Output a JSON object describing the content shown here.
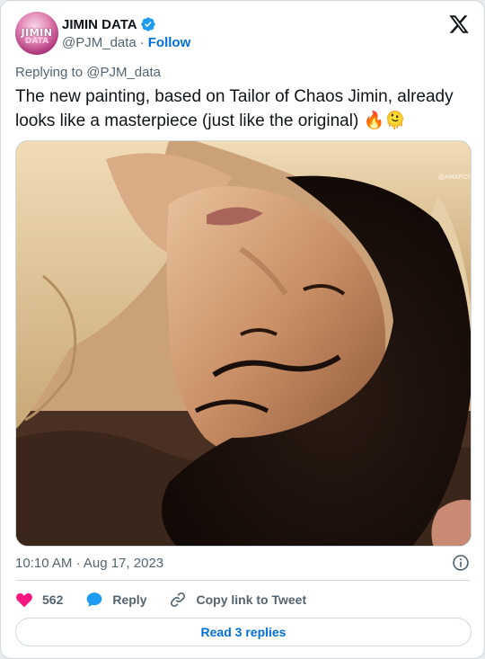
{
  "author": {
    "display_name": "JIMIN DATA",
    "handle": "@PJM_data",
    "separator": "·",
    "follow_label": "Follow",
    "avatar_logo_text": "JIMIN",
    "avatar_logo_sub": "DATA",
    "verified_color": "#1d9bf0"
  },
  "reply_context": {
    "prefix": "Replying to",
    "mention": "@PJM_data"
  },
  "tweet": {
    "text": "The new painting, based on Tailor of Chaos Jimin, already looks like a masterpiece (just like the original)",
    "emoji": "🔥🫠",
    "photo_watermark": "@AMAROS"
  },
  "meta": {
    "timestamp": "10:10 AM · Aug 17, 2023"
  },
  "actions": {
    "like_count": "562",
    "reply_label": "Reply",
    "copy_label": "Copy link to Tweet"
  },
  "footer": {
    "read_replies_label": "Read 3 replies"
  },
  "colors": {
    "like": "#f91880",
    "reply": "#1d9bf0",
    "link": "#006fd6",
    "muted": "#536471"
  },
  "icons": {
    "logo": "x-logo-icon",
    "verified": "verified-badge-icon",
    "info": "info-icon",
    "like": "heart-icon",
    "reply": "speech-bubble-icon",
    "copy": "link-icon"
  }
}
